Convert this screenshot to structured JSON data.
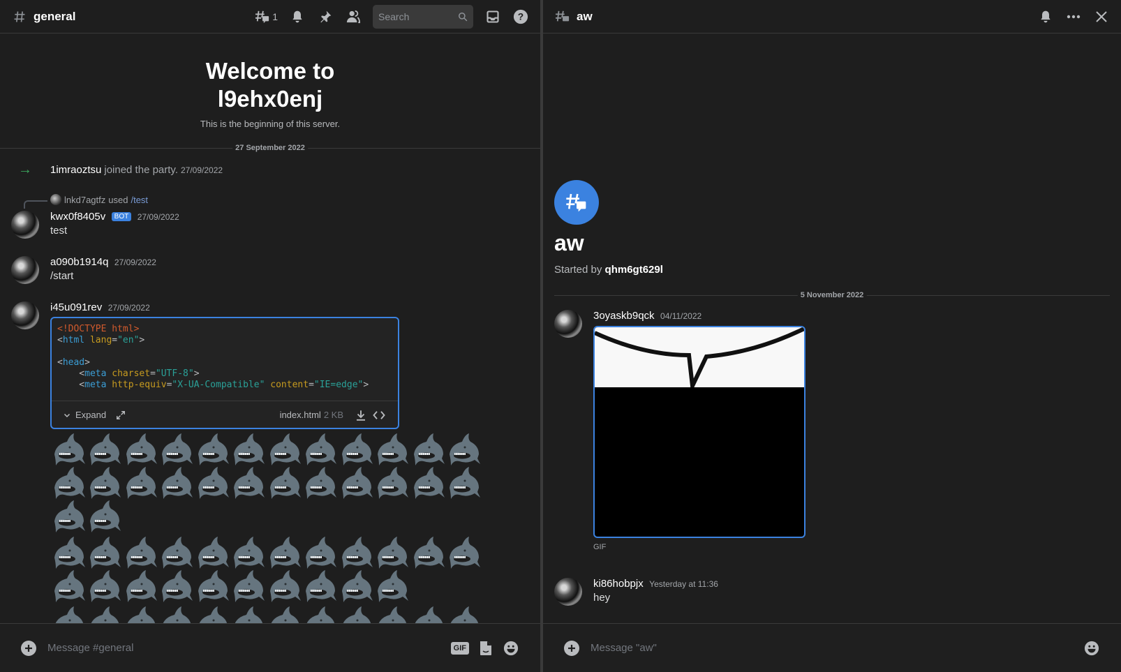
{
  "left": {
    "header": {
      "channel_name": "general",
      "thread_count": "1",
      "search_placeholder": "Search"
    },
    "welcome": {
      "title_line1": "Welcome to",
      "title_line2": "l9ehx0enj",
      "subtitle": "This is the beginning of this server."
    },
    "date_separator": "27 September 2022",
    "join_event": {
      "username": "1imraoztsu",
      "text": "joined the party.",
      "timestamp": "27/09/2022"
    },
    "messages": [
      {
        "reply": {
          "username": "lnkd7agtfz",
          "used": "used",
          "command": "/test"
        },
        "username": "kwx0f8405v",
        "badge": "BOT",
        "timestamp": "27/09/2022",
        "content": "test"
      },
      {
        "username": "a090b1914q",
        "timestamp": "27/09/2022",
        "content": "/start"
      },
      {
        "username": "i45u091rev",
        "timestamp": "27/09/2022",
        "attachment": {
          "code_lines": [
            "<!DOCTYPE html>",
            "<html lang=\"en\">",
            "",
            "<head>",
            "    <meta charset=\"UTF-8\">",
            "    <meta http-equiv=\"X-UA-Compatible\" content=\"IE=edge\">"
          ],
          "expand_label": "Expand",
          "filename": "index.html",
          "filesize": "2 KB"
        },
        "emoji_groups": [
          {
            "emoji": "shark",
            "count": 26
          },
          {
            "emoji": "shark",
            "count": 22
          },
          {
            "emoji": "shark",
            "count": 12
          }
        ]
      }
    ],
    "composer": {
      "placeholder": "Message #general",
      "gif_label": "GIF"
    }
  },
  "right": {
    "header": {
      "thread_name": "aw"
    },
    "thread_title": "aw",
    "started_by_label": "Started by",
    "started_by_user": "qhm6gt629l",
    "date_separator": "5 November 2022",
    "messages": [
      {
        "username": "3oyaskb9qck",
        "timestamp": "04/11/2022",
        "attachment_label": "GIF"
      },
      {
        "username": "ki86hobpjx",
        "timestamp": "Yesterday at 11:36",
        "content": "hey"
      }
    ],
    "composer": {
      "placeholder": "Message \"aw\""
    }
  },
  "colors": {
    "accent": "#3b82e0",
    "background": "#1e1e1e",
    "join_arrow": "#3ba55d",
    "shark": "#66757f"
  }
}
